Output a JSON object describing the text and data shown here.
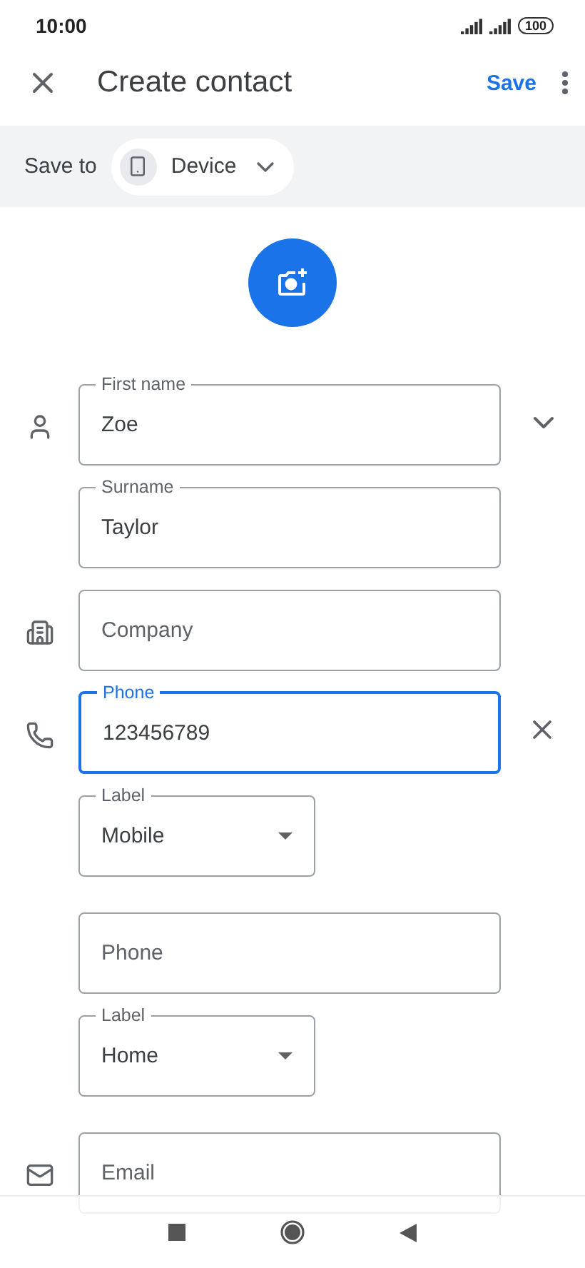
{
  "status_bar": {
    "time": "10:00",
    "battery": "100"
  },
  "header": {
    "title": "Create contact",
    "save": "Save"
  },
  "save_to": {
    "label": "Save to",
    "account": "Device"
  },
  "groups": [
    {
      "fields": [
        {
          "kind": "text",
          "label": "First name",
          "value": "Zoe",
          "focused": false
        },
        {
          "kind": "text",
          "label": "Surname",
          "value": "Taylor",
          "focused": false
        }
      ]
    },
    {
      "fields": [
        {
          "kind": "text",
          "placeholder": "Company",
          "focused": false
        }
      ]
    },
    {
      "fields": [
        {
          "kind": "text",
          "label": "Phone",
          "value": "123456789",
          "focused": true
        },
        {
          "kind": "select",
          "label": "Label",
          "value": "Mobile"
        },
        {
          "kind": "text",
          "placeholder": "Phone",
          "focused": false
        },
        {
          "kind": "select",
          "label": "Label",
          "value": "Home"
        }
      ]
    },
    {
      "fields": [
        {
          "kind": "text",
          "placeholder": "Email",
          "focused": false
        }
      ]
    }
  ]
}
